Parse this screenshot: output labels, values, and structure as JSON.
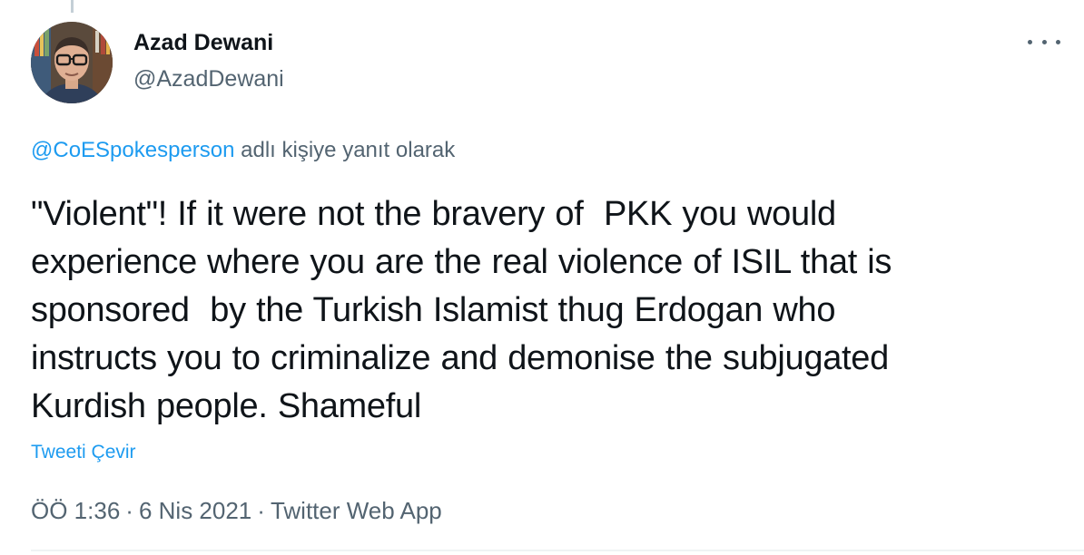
{
  "author": {
    "display_name": "Azad Dewani",
    "handle": "@AzadDewani"
  },
  "reply_context": {
    "mention": "@CoESpokesperson",
    "suffix": " adlı kişiye yanıt olarak"
  },
  "tweet": {
    "text_lines": [
      "\"Violent\"! If it were not the bravery of  PKK you would",
      "experience where you are the real violence of ISIL that is",
      "sponsored  by the Turkish Islamist thug Erdogan who",
      "instructs you to criminalize and demonise the subjugated",
      "Kurdish people. Shameful"
    ],
    "translate_label": "Tweeti Çevir"
  },
  "meta": {
    "time": "ÖÖ 1:36",
    "separator": "·",
    "date": "6 Nis 2021",
    "source": "Twitter Web App"
  },
  "icons": {
    "more": "more-horizontal-icon"
  },
  "colors": {
    "accent": "#1d9bf0",
    "secondary_text": "#536471",
    "primary_text": "#0f1419"
  }
}
